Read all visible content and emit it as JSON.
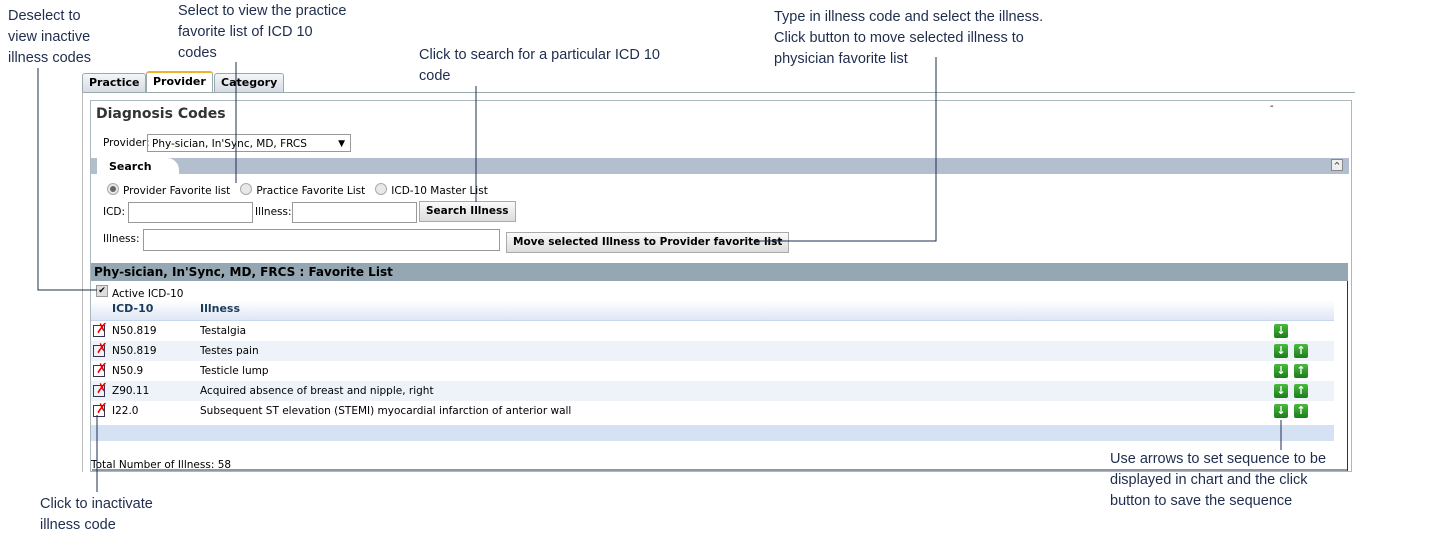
{
  "annotations": {
    "deselect": "Deselect to view inactive illness codes",
    "practice_list": "Select to view the practice favorite list of ICD 10 codes",
    "search": "Click to search for a particular ICD 10 code",
    "move": "Type in illness code and select the illness. Click button to move selected illness to physician favorite list",
    "inactivate": "Click to inactivate illness code",
    "arrows": "Use arrows to set sequence to be displayed in chart and the click button to save the sequence"
  },
  "tabs": [
    "Practice",
    "Provider",
    "Category"
  ],
  "active_tab": "Provider",
  "title": "Diagnosis Codes",
  "provider": {
    "label": "Provider:",
    "value": "Phy-sician, In'Sync, MD, FRCS"
  },
  "search": {
    "tab_label": "Search",
    "radios": [
      {
        "label": "Provider Favorite list",
        "checked": true
      },
      {
        "label": "Practice Favorite List",
        "checked": false
      },
      {
        "label": "ICD-10 Master List",
        "checked": false
      }
    ],
    "icd_label": "ICD:",
    "illness_label": "Illness:",
    "search_button": "Search Illness",
    "illness2_label": "Illness:",
    "move_button": "Move selected Illness to Provider favorite list"
  },
  "favorites": {
    "header": "Phy-sician, In'Sync, MD, FRCS : Favorite List",
    "active_label": "Active ICD-10",
    "active_checked": true,
    "columns": [
      "ICD-10",
      "Illness"
    ],
    "rows": [
      {
        "code": "N50.819",
        "illness": "Testalgia"
      },
      {
        "code": "N50.819",
        "illness": "Testes pain"
      },
      {
        "code": "N50.9",
        "illness": "Testicle lump"
      },
      {
        "code": "Z90.11",
        "illness": "Acquired absence of breast and nipple, right"
      },
      {
        "code": "I22.0",
        "illness": "Subsequent ST elevation (STEMI) myocardial infarction of anterior wall"
      }
    ],
    "total": "Total Number of Illness: 58"
  },
  "colors": {
    "section_header": "#94a7b2",
    "search_bar": "#b3bfcf",
    "arrow_green": "#2a9a2a",
    "annotation_text": "#1f2d4d"
  }
}
